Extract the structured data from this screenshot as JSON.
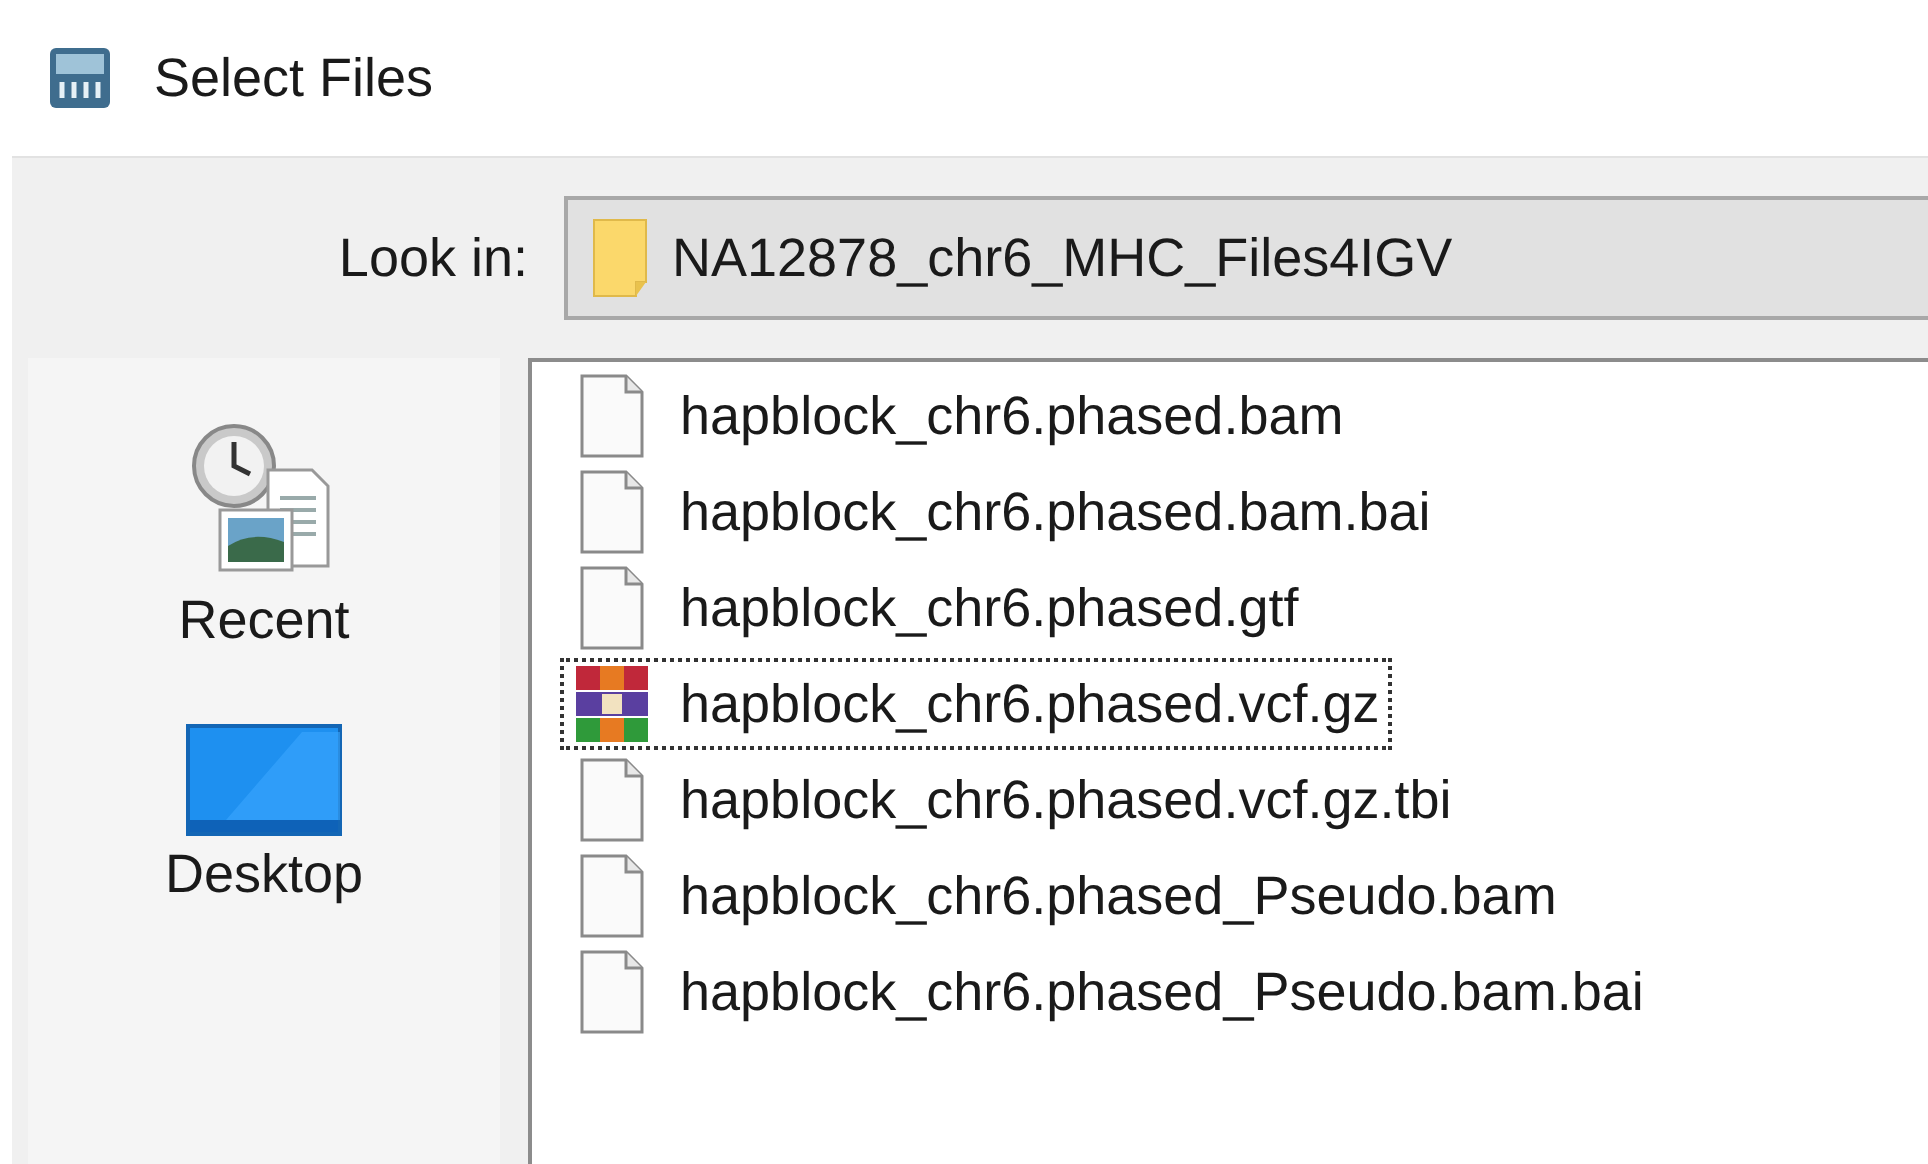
{
  "window": {
    "title": "Select Files"
  },
  "look_in": {
    "label": "Look in:",
    "value": "NA12878_chr6_MHC_Files4IGV"
  },
  "sidebar": {
    "items": [
      {
        "label": "Recent",
        "kind": "recent"
      },
      {
        "label": "Desktop",
        "kind": "desktop"
      }
    ]
  },
  "files": [
    {
      "name": "hapblock_chr6.phased.bam",
      "kind": "document",
      "selected": false
    },
    {
      "name": "hapblock_chr6.phased.bam.bai",
      "kind": "document",
      "selected": false
    },
    {
      "name": "hapblock_chr6.phased.gtf",
      "kind": "document",
      "selected": false
    },
    {
      "name": "hapblock_chr6.phased.vcf.gz",
      "kind": "archive",
      "selected": true
    },
    {
      "name": "hapblock_chr6.phased.vcf.gz.tbi",
      "kind": "document",
      "selected": false
    },
    {
      "name": "hapblock_chr6.phased_Pseudo.bam",
      "kind": "document",
      "selected": false
    },
    {
      "name": "hapblock_chr6.phased_Pseudo.bam.bai",
      "kind": "document",
      "selected": false
    }
  ]
}
